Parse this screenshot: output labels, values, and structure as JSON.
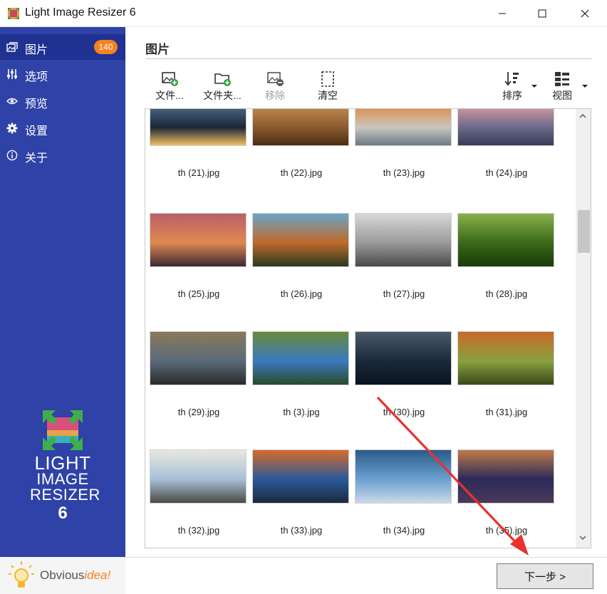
{
  "window": {
    "title": "Light Image Resizer 6"
  },
  "sidebar": {
    "items": [
      {
        "label": "图片",
        "icon": "images-icon",
        "badge": "140",
        "active": true
      },
      {
        "label": "选项",
        "icon": "sliders-icon"
      },
      {
        "label": "预览",
        "icon": "eye-icon"
      },
      {
        "label": "设置",
        "icon": "gear-icon"
      },
      {
        "label": "关于",
        "icon": "info-icon"
      }
    ],
    "logo": {
      "line1": "LIGHT",
      "line2": "IMAGE",
      "line3": "RESIZER",
      "version": "6"
    },
    "footer": {
      "brand_a": "Obvious",
      "brand_b": "idea!"
    }
  },
  "main": {
    "title": "图片",
    "toolbar": {
      "add_files": "文件...",
      "add_folder": "文件夹...",
      "remove": "移除",
      "clear": "清空",
      "sort": "排序",
      "view": "视图"
    },
    "files": [
      {
        "name": "th (21).jpg",
        "colors": [
          "#1b2636",
          "#4d6a8a",
          "#f0c060"
        ]
      },
      {
        "name": "th (22).jpg",
        "colors": [
          "#8a5a2e",
          "#c28a52",
          "#4a2e14"
        ]
      },
      {
        "name": "th (23).jpg",
        "colors": [
          "#c9c6c0",
          "#e08a40",
          "#6a7a84"
        ]
      },
      {
        "name": "th (24).jpg",
        "colors": [
          "#6a6a8a",
          "#d89aa0",
          "#3a3a58"
        ]
      },
      {
        "name": "th (25).jpg",
        "colors": [
          "#e08850",
          "#b8606a",
          "#3a2a36"
        ]
      },
      {
        "name": "th (26).jpg",
        "colors": [
          "#c06a2a",
          "#6aa4c8",
          "#2a3a22"
        ]
      },
      {
        "name": "th (27).jpg",
        "colors": [
          "#9a9a9a",
          "#d8d8d8",
          "#4a4a4a"
        ]
      },
      {
        "name": "th (28).jpg",
        "colors": [
          "#3a6a1a",
          "#8ab04a",
          "#1a3a0a"
        ]
      },
      {
        "name": "th (29).jpg",
        "colors": [
          "#5a6a7a",
          "#8a7a5a",
          "#2a2a2a"
        ]
      },
      {
        "name": "th (3).jpg",
        "colors": [
          "#3a7ac0",
          "#6a8a3a",
          "#2a4a2a"
        ]
      },
      {
        "name": "th (30).jpg",
        "colors": [
          "#1a2838",
          "#4a5a6a",
          "#0a1420"
        ]
      },
      {
        "name": "th (31).jpg",
        "colors": [
          "#8aa040",
          "#c86a2a",
          "#3a4a1a"
        ]
      },
      {
        "name": "th (32).jpg",
        "colors": [
          "#a8c0d8",
          "#e8e8e0",
          "#4a4a48"
        ]
      },
      {
        "name": "th (33).jpg",
        "colors": [
          "#2a5a9a",
          "#d86a2a",
          "#1a2a3a"
        ]
      },
      {
        "name": "th (34).jpg",
        "colors": [
          "#6aa0d0",
          "#2a5a8a",
          "#c8d8e8"
        ]
      },
      {
        "name": "th (35).jpg",
        "colors": [
          "#2a2a5a",
          "#c07a4a",
          "#4a3a5a"
        ]
      }
    ]
  },
  "footer": {
    "next": "下一步 >"
  },
  "colors": {
    "sidebar": "#2e42a7",
    "sidebar_active": "#1f3291",
    "badge": "#f58220",
    "arrow": "#e8322b"
  }
}
